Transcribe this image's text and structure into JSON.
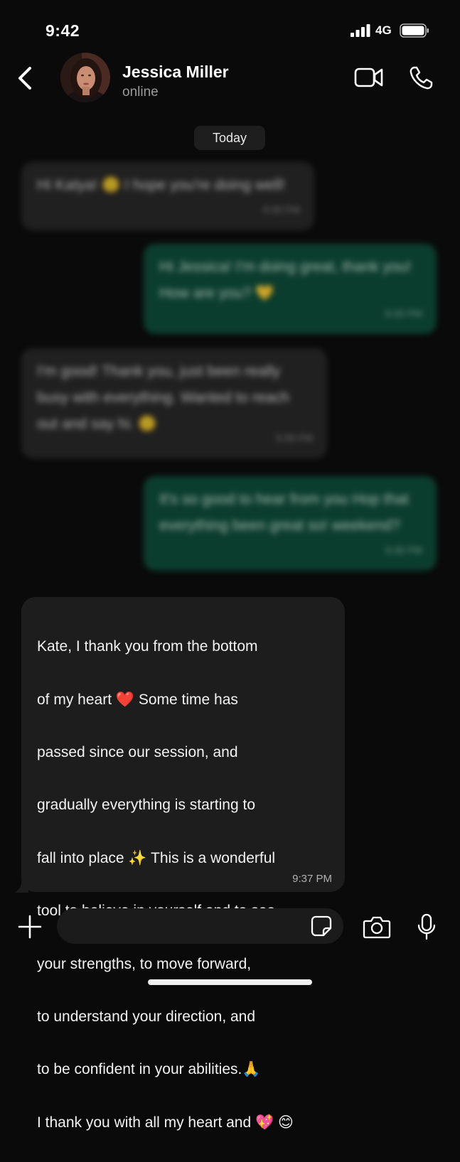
{
  "status_bar": {
    "time": "9:42",
    "network": "4G"
  },
  "header": {
    "contact_name": "Jessica Miller",
    "contact_status": "online"
  },
  "chat": {
    "date_separator": "Today",
    "blurred_messages": [
      {
        "direction": "incoming",
        "text": "Hi Katya! 🙂 I hope you're doing well!",
        "time": "9:35 PM"
      },
      {
        "direction": "outgoing",
        "text": "Hi Jessica! I'm doing great, thank you! How are you? 💛",
        "time": "9:35 PM"
      },
      {
        "direction": "incoming",
        "text": "I'm good! Thank you, just been really busy with everything. Wanted to reach out and say hi. 🙂",
        "time": "9:36 PM"
      },
      {
        "direction": "outgoing",
        "text": "It's so good to hear from you Hop that everything been great so! weekend?",
        "time": "9:36 PM"
      }
    ],
    "main_message": {
      "lines": [
        "Kate, I thank you from the bottom",
        "of my heart ❤️ Some time has",
        "passed since our session, and",
        "gradually everything is starting to",
        "fall into place ✨ This is a wonderful",
        "tool to believe in yourself and to see",
        "your strengths, to move forward,",
        "to understand your direction, and",
        "to be confident in your abilities.🙏",
        "I thank you with all my heart and 💖 😊"
      ],
      "time": "9:37 PM"
    }
  },
  "composer": {
    "placeholder": ""
  },
  "icons": {
    "back": "chevron-left-icon",
    "video": "video-camera-icon",
    "call": "phone-icon",
    "add": "plus-icon",
    "sticker": "sticker-icon",
    "camera": "camera-icon",
    "mic": "microphone-icon"
  },
  "colors": {
    "background": "#0a0a0a",
    "incoming_bubble": "#1d1d1d",
    "outgoing_bubble": "#0c4a37",
    "read_receipt": "#4aa3df"
  }
}
